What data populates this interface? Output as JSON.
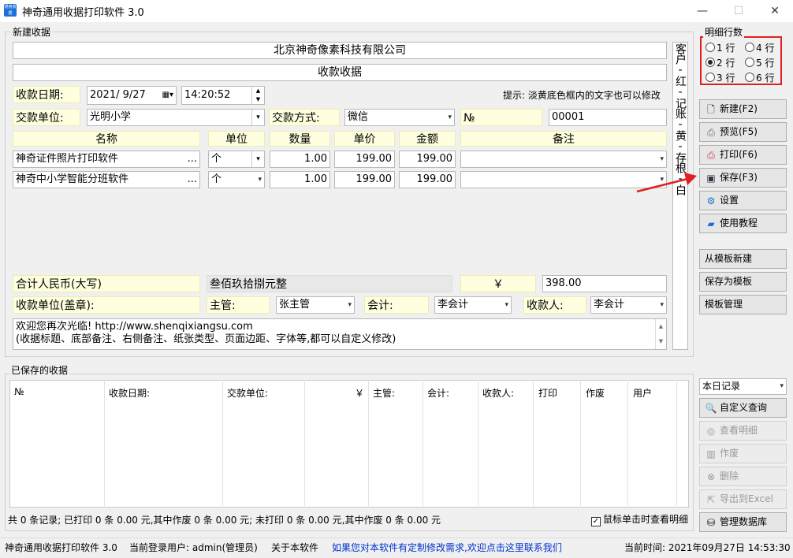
{
  "window": {
    "title": "神奇通用收据打印软件 3.0",
    "icon_text": "通用收据",
    "min": "—",
    "max": "☐",
    "close": "✕"
  },
  "form": {
    "group_label": "新建收据",
    "company": "北京神奇像素科技有限公司",
    "receipt_title": "收款收据",
    "date_label": "收款日期:",
    "date_value": "2021/ 9/27",
    "time_value": "14:20:52",
    "hint": "提示: 淡黄底色框内的文字也可以修改",
    "payer_label": "交款单位:",
    "payer_value": "光明小学",
    "method_label": "交款方式:",
    "method_value": "微信",
    "no_label": "№",
    "no_value": "00001",
    "headers": {
      "name": "名称",
      "unit": "单位",
      "qty": "数量",
      "price": "单价",
      "amount": "金额",
      "note": "备注"
    },
    "rows": [
      {
        "name": "神奇证件照片打印软件",
        "unit": "个",
        "qty": "1.00",
        "price": "199.00",
        "amount": "199.00",
        "note": ""
      },
      {
        "name": "神奇中小学智能分班软件",
        "unit": "个",
        "qty": "1.00",
        "price": "199.00",
        "amount": "199.00",
        "note": ""
      }
    ],
    "total_label": "合计人民币(大写)",
    "total_words": "叁佰玖拾捌元整",
    "yen": "￥",
    "total_value": "398.00",
    "stamp_label": "收款单位(盖章):",
    "supervisor_label": "主管:",
    "supervisor_value": "张主管",
    "accountant_label": "会计:",
    "accountant_value": "李会计",
    "cashier_label": "收款人:",
    "cashier_value": "李会计",
    "footer_line1": "欢迎您再次光临! http://www.shenqixiangsu.com",
    "footer_line2": "(收据标题、底部备注、右侧备注、纸张类型、页面边距、字体等,都可以自定义修改)",
    "side_note": "客户-红-记账-黄-存根-白",
    "ellipsis": "..."
  },
  "rows_group": {
    "label": "明细行数",
    "options": [
      "1 行",
      "4 行",
      "2 行",
      "5 行",
      "3 行",
      "6 行"
    ],
    "selected": "2 行"
  },
  "actions": {
    "new": "新建(F2)",
    "preview": "预览(F5)",
    "print": "打印(F6)",
    "save": "保存(F3)",
    "settings": "设置",
    "tutorial": "使用教程",
    "from_template": "从模板新建",
    "save_template": "保存为模板",
    "manage_template": "模板管理"
  },
  "saved": {
    "group_label": "已保存的收据",
    "columns": [
      "№",
      "收款日期:",
      "交款单位:",
      "￥",
      "主管:",
      "会计:",
      "收款人:",
      "打印",
      "作废",
      "用户"
    ],
    "filter": "本日记录",
    "buttons": {
      "custom_query": "自定义查询",
      "view_detail": "查看明细",
      "void": "作废",
      "delete": "删除",
      "export": "导出到Excel",
      "manage_db": "管理数据库"
    },
    "summary": "共 0 条记录;  已打印 0 条 0.00 元,其中作废 0 条 0.00 元;  未打印 0 条 0.00 元,其中作废 0 条 0.00 元",
    "click_check": "鼠标单击时查看明细"
  },
  "status": {
    "app": "神奇通用收据打印软件 3.0",
    "user": "当前登录用户: admin(管理员)",
    "about": "关于本软件",
    "link": "如果您对本软件有定制修改需求,欢迎点击这里联系我们",
    "time": "当前时间: 2021年09月27日 14:53:30"
  },
  "colors": {
    "highlight": "#ffffe0",
    "arrow": "#e02020",
    "link": "#0033cc"
  }
}
